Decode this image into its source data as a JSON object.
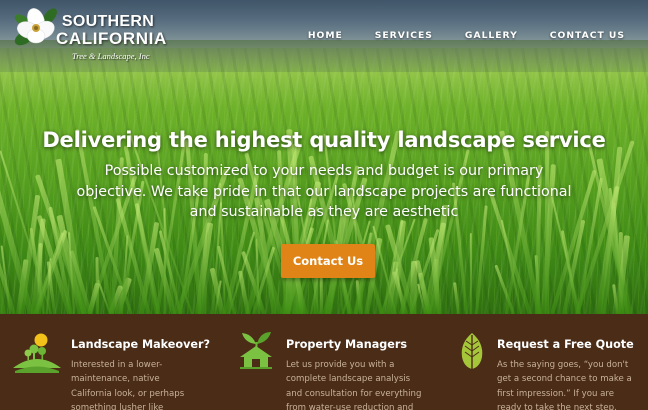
{
  "brand": {
    "line1": "SOUTHERN",
    "line2": "CALIFORNIA",
    "subtitle": "Tree & Landscape, Inc"
  },
  "nav": {
    "items": [
      "HOME",
      "SERVICES",
      "GALLERY",
      "CONTACT US"
    ]
  },
  "hero": {
    "title": "Delivering the highest quality landscape service",
    "text": "Possible customized to your needs and budget is our primary objective. We take pride in that our landscape projects are functional and sustainable as they are aesthetic",
    "button_label": "Contact Us"
  },
  "features": [
    {
      "icon": "sun-landscape-icon",
      "title": "Landscape Makeover?",
      "text": "Interested in a lower-maintenance, native California look, or perhaps something lusher like"
    },
    {
      "icon": "house-sprout-icon",
      "title": "Property Managers",
      "text": "Let us provide you with a complete landscape analysis and consultation for everything from water-use reduction and"
    },
    {
      "icon": "leaf-icon",
      "title": "Request a Free Quote",
      "text": "As the saying goes, “you don't get a second chance to make a first impression.” If you are ready to take the next step, give us a call"
    }
  ],
  "colors": {
    "accent_orange": "#e08417",
    "footer_brown": "#4a2c17",
    "icon_green": "#7cc242",
    "feature_text": "#c9b29a"
  }
}
